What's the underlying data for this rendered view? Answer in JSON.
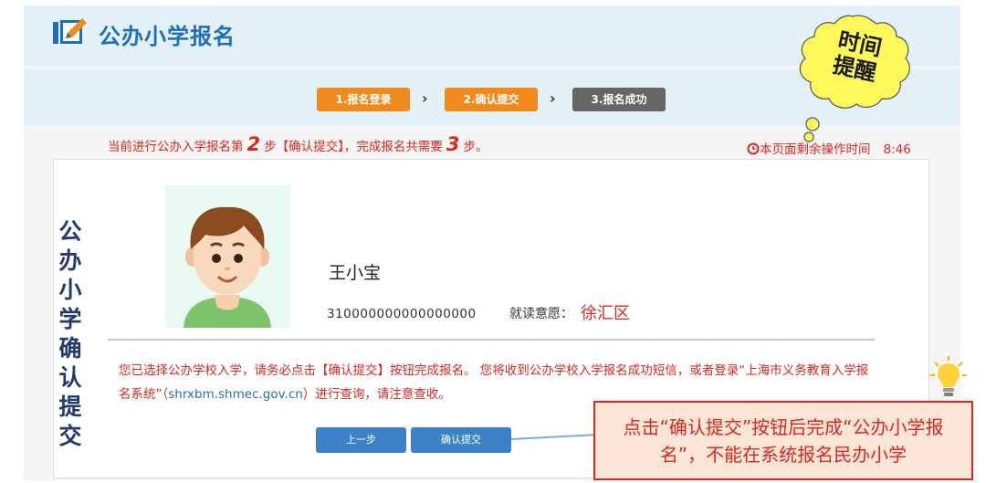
{
  "header": {
    "title": "公办小学报名",
    "logo_icon": "pencil-edit-icon"
  },
  "steps": [
    {
      "label": "1.报名登录",
      "color": "#f08a1c"
    },
    {
      "label": "2.确认提交",
      "color": "#f08a1c"
    },
    {
      "label": "3.报名成功",
      "color": "#666666"
    }
  ],
  "step_separator": "›",
  "progress": {
    "prefix": "当前进行公办入学报名第",
    "current_step": "2",
    "middle": "步【确认提交】，完成报名共需要",
    "total_steps": "3",
    "suffix": "步。"
  },
  "timer": {
    "icon": "clock-icon",
    "label": "本页面剩余操作时间",
    "value": "8:46"
  },
  "bubble": {
    "text": "时间提醒"
  },
  "side_title": [
    "公",
    "办",
    "小",
    "学",
    "确",
    "认",
    "提",
    "交"
  ],
  "student": {
    "name": "王小宝",
    "id": "310000000000000000",
    "intent_label": "就读意愿：",
    "intent_value": "徐汇区"
  },
  "notice": {
    "part1": "您已选择公办学校入学，请务必点击【确认提交】按钮完成报名。 您将收到公办学校入学报名成功短信，或者登录“上海市义务教育入学报名系统”（",
    "link": "shrxbm.shmec.gov.cn",
    "part2": "）进行查询，请注意查收。"
  },
  "buttons": {
    "prev": "上一步",
    "submit": "确认提交"
  },
  "callout": {
    "text": "点击“确认提交”按钮后完成“公办小学报名”，不能在系统报名民办小学"
  },
  "colors": {
    "accent_orange": "#f08a1c",
    "primary_blue": "#3b83c6",
    "alert_red": "#d9281f",
    "header_bg": "#e3f0f8"
  }
}
